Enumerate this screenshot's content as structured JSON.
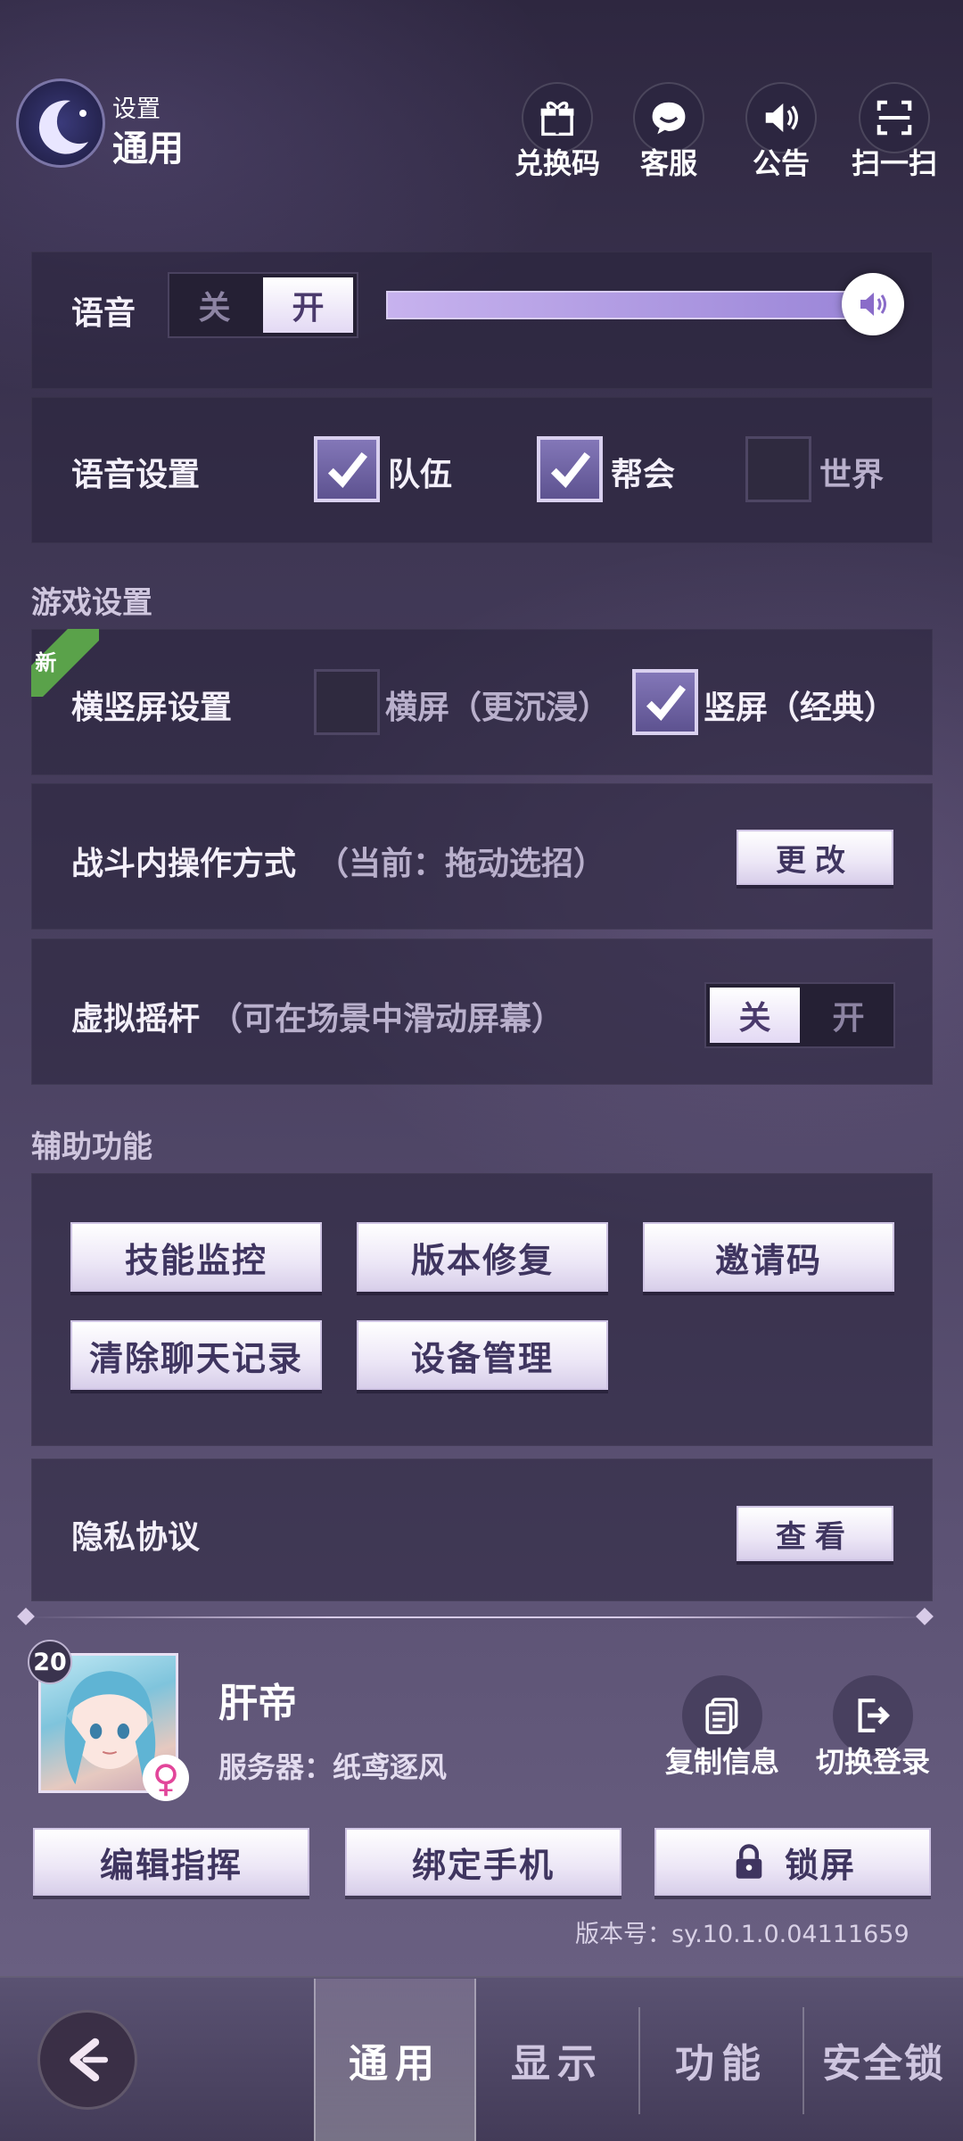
{
  "header": {
    "subtitle": "设置",
    "title": "通用"
  },
  "top_actions": [
    {
      "label": "兑换码",
      "icon": "gift-icon"
    },
    {
      "label": "客服",
      "icon": "chat-bubble-icon"
    },
    {
      "label": "公告",
      "icon": "speaker-icon"
    },
    {
      "label": "扫一扫",
      "icon": "scan-icon"
    }
  ],
  "voice": {
    "label": "语音",
    "off": "关",
    "on": "开",
    "state": "on",
    "volume": 1.0
  },
  "voice_settings": {
    "label": "语音设置",
    "options": [
      {
        "label": "队伍",
        "checked": true
      },
      {
        "label": "帮会",
        "checked": true
      },
      {
        "label": "世界",
        "checked": false
      }
    ]
  },
  "game_section": {
    "title": "游戏设置"
  },
  "orientation": {
    "badge": "新",
    "label": "横竖屏设置",
    "landscape": "横屏（更沉浸）",
    "portrait": "竖屏（经典）",
    "landscape_checked": false,
    "portrait_checked": true
  },
  "battle": {
    "label": "战斗内操作方式",
    "note": "（当前：拖动选招）",
    "button": "更改"
  },
  "joystick": {
    "label": "虚拟摇杆",
    "note": "（可在场景中滑动屏幕）",
    "off": "关",
    "on": "开",
    "state": "off"
  },
  "assist_section": {
    "title": "辅助功能"
  },
  "assist_buttons": [
    "技能监控",
    "版本修复",
    "邀请码",
    "清除聊天记录",
    "设备管理"
  ],
  "privacy": {
    "label": "隐私协议",
    "button": "查看"
  },
  "profile": {
    "level": "20",
    "name": "肝帝",
    "server": "服务器：纸鸢逐风",
    "gender": "♀",
    "copy_label": "复制信息",
    "switch_label": "切换登录"
  },
  "bottom_buttons": {
    "edit": "编辑指挥",
    "bind": "绑定手机",
    "lock": "锁屏"
  },
  "version": "版本号：sy.10.1.0.04111659",
  "tabs": [
    {
      "label": "通用",
      "active": true
    },
    {
      "label": "显示",
      "active": false
    },
    {
      "label": "功能",
      "active": false
    },
    {
      "label": "安全锁",
      "active": false
    }
  ],
  "colors": {
    "accent": "#b49ae6",
    "panel": "#2a2340",
    "button": "#f3eefb"
  }
}
